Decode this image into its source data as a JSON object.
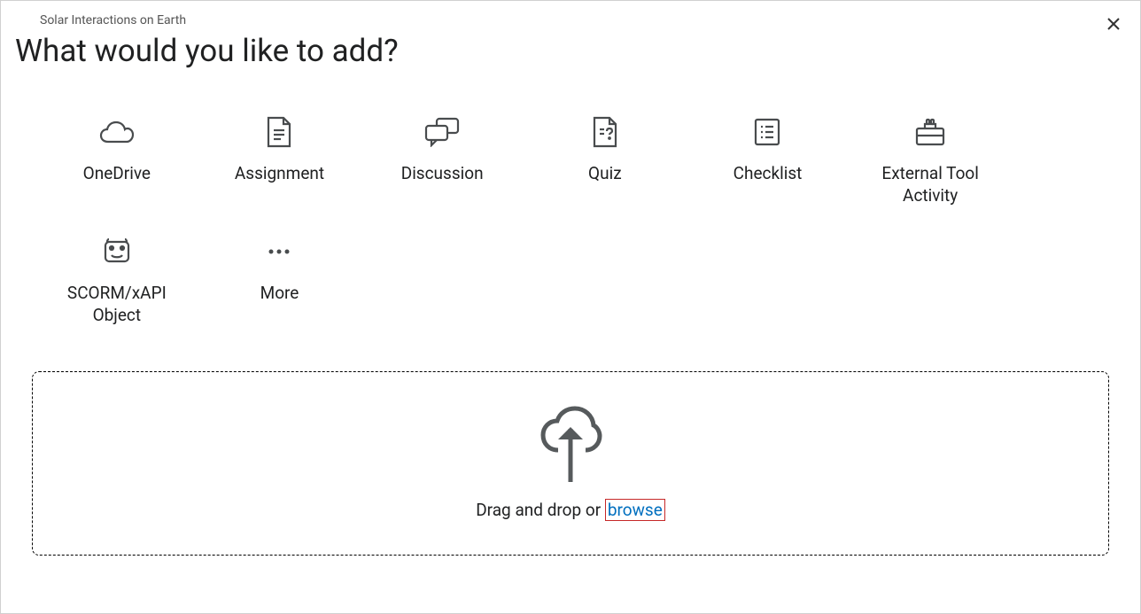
{
  "header": {
    "breadcrumb": "Solar Interactions on Earth",
    "title": "What would you like to add?"
  },
  "options": [
    {
      "label": "OneDrive"
    },
    {
      "label": "Assignment"
    },
    {
      "label": "Discussion"
    },
    {
      "label": "Quiz"
    },
    {
      "label": "Checklist"
    },
    {
      "label": "External Tool Activity"
    },
    {
      "label": "SCORM/xAPI Object"
    },
    {
      "label": "More"
    }
  ],
  "dropzone": {
    "prefix": "Drag and drop or ",
    "browse": "browse"
  }
}
